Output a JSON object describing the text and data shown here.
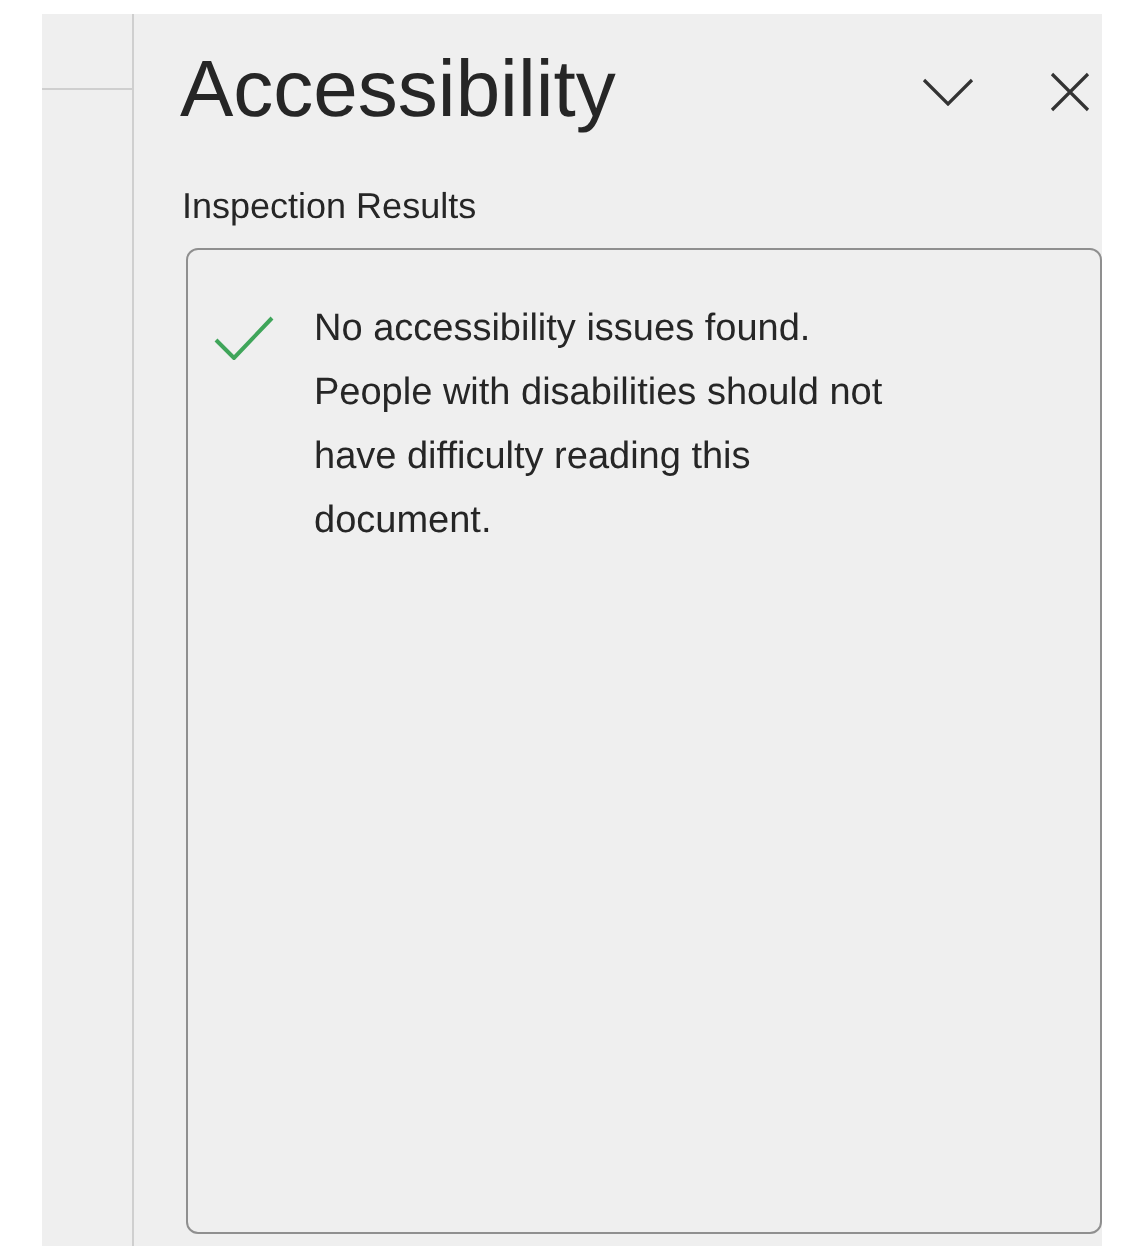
{
  "pane": {
    "title": "Accessibility",
    "section_label": "Inspection Results",
    "results": [
      {
        "kind": "success",
        "message": "No accessibility issues found. People with disabilities should not have difficulty reading this document."
      }
    ]
  }
}
